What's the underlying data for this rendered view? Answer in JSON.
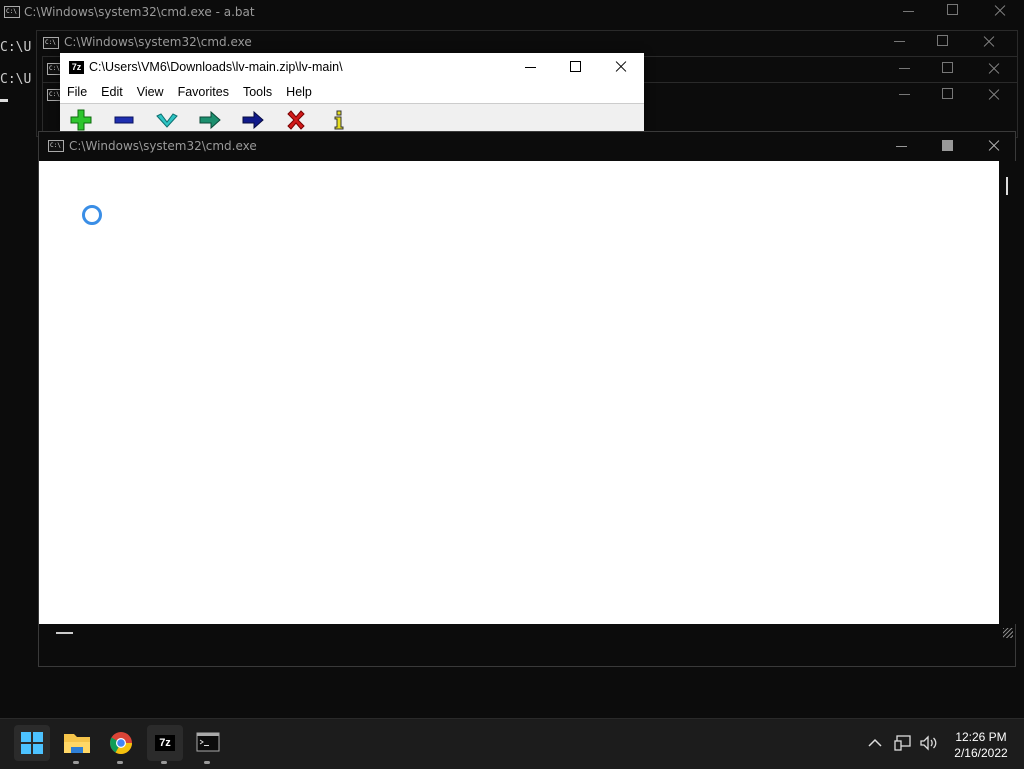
{
  "windows": {
    "back_cmd": {
      "title": "C:\\Windows\\system32\\cmd.exe - a.bat",
      "prompt_line_1": "C:\\U",
      "prompt_line_2": "C:\\U"
    },
    "cmd_2": {
      "title": "C:\\Windows\\system32\\cmd.exe"
    },
    "sevenzip": {
      "title": "C:\\Users\\VM6\\Downloads\\lv-main.zip\\lv-main\\",
      "menu": [
        "File",
        "Edit",
        "View",
        "Favorites",
        "Tools",
        "Help"
      ],
      "toolbar": [
        {
          "icon": "add-icon",
          "color": "#2fc52f"
        },
        {
          "icon": "extract-icon",
          "color": "#1f2fb0"
        },
        {
          "icon": "test-icon",
          "color": "#2ec4c4"
        },
        {
          "icon": "copy-icon",
          "color": "#1c8f6e"
        },
        {
          "icon": "move-icon",
          "color": "#101a8a"
        },
        {
          "icon": "delete-icon",
          "color": "#d11a1a"
        },
        {
          "icon": "info-icon",
          "color": "#e8e020"
        }
      ]
    },
    "front_cmd": {
      "title": "C:\\Windows\\system32\\cmd.exe",
      "status": "loading"
    }
  },
  "taskbar": {
    "apps": [
      "start-icon",
      "file-explorer-icon",
      "chrome-icon",
      "7zip-icon",
      "terminal-icon"
    ],
    "sevenzip_label": "7z",
    "time": "12:26 PM",
    "date": "2/16/2022"
  }
}
